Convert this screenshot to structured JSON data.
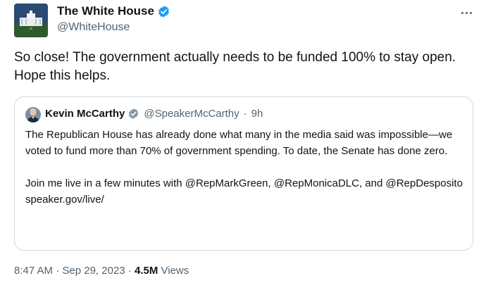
{
  "author": {
    "name": "The White House",
    "handle": "@WhiteHouse"
  },
  "tweet": {
    "text": "So close! The government actually needs to be funded 100% to stay open. Hope this helps."
  },
  "quote": {
    "name": "Kevin McCarthy",
    "handle": "@SpeakerMcCarthy",
    "separator": "·",
    "time": "9h",
    "paragraph1": "The Republican House has already done what many in the media said was impossible—we voted to fund more than 70% of government spending. To date, the Senate has done zero.",
    "paragraph2": "Join me live in a few minutes with @RepMarkGreen, @RepMonicaDLC, and @RepDesposito",
    "link": "speaker.gov/live/"
  },
  "footer": {
    "time": "8:47 AM",
    "sep1": "·",
    "date": "Sep 29, 2023",
    "sep2": "·",
    "views_count": "4.5M",
    "views_label": "Views"
  },
  "colors": {
    "verified": "#1d9bf0",
    "secondary_text": "#536471",
    "border": "#cfd9de"
  },
  "icons": {
    "verified": "verified-badge-icon",
    "more": "more-options-icon"
  }
}
